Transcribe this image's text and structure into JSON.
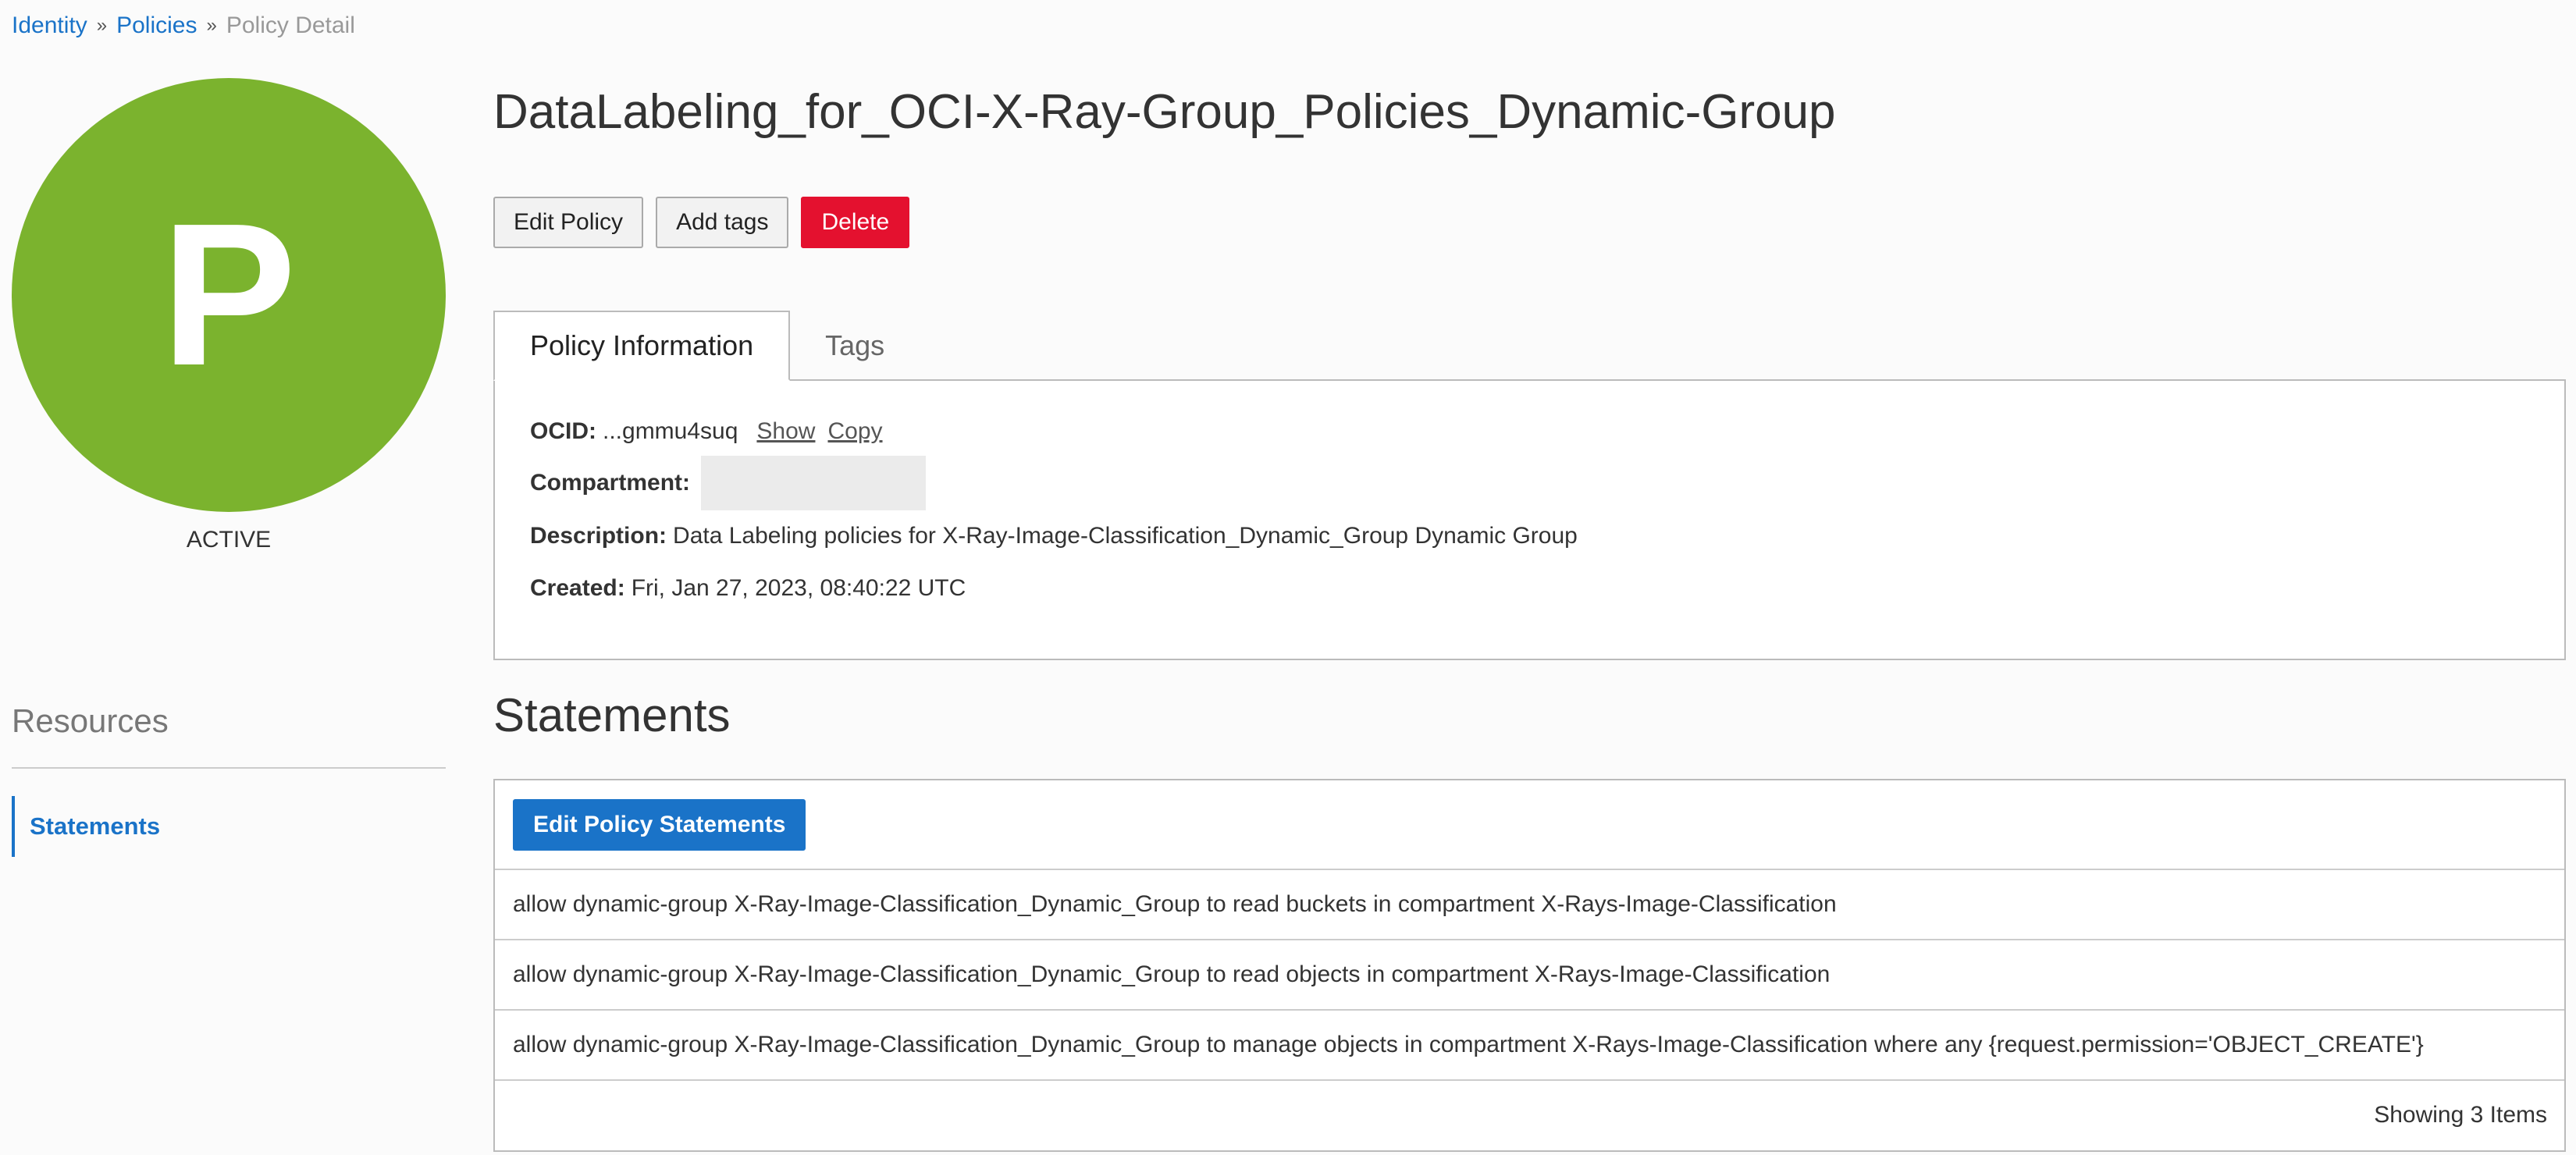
{
  "breadcrumb": {
    "identity": "Identity",
    "policies": "Policies",
    "current": "Policy Detail",
    "separator": "»"
  },
  "avatar": {
    "letter": "P",
    "color": "#7bb32e"
  },
  "status": "ACTIVE",
  "title": "DataLabeling_for_OCI-X-Ray-Group_Policies_Dynamic-Group",
  "actions": {
    "edit_policy": "Edit Policy",
    "add_tags": "Add tags",
    "delete": "Delete"
  },
  "tabs": [
    {
      "label": "Policy Information",
      "active": true
    },
    {
      "label": "Tags",
      "active": false
    }
  ],
  "policy_info": {
    "ocid_label": "OCID:",
    "ocid_value": "...gmmu4suq",
    "show_link": "Show",
    "copy_link": "Copy",
    "compartment_label": "Compartment:",
    "description_label": "Description:",
    "description_value": "Data Labeling policies for X-Ray-Image-Classification_Dynamic_Group Dynamic Group",
    "created_label": "Created:",
    "created_value": "Fri, Jan 27, 2023, 08:40:22 UTC"
  },
  "resources": {
    "heading": "Resources",
    "items": [
      {
        "label": "Statements",
        "active": true
      }
    ]
  },
  "statements": {
    "heading": "Statements",
    "edit_button": "Edit Policy Statements",
    "rows": [
      "allow dynamic-group X-Ray-Image-Classification_Dynamic_Group to read buckets in compartment X-Rays-Image-Classification",
      "allow dynamic-group X-Ray-Image-Classification_Dynamic_Group to read objects in compartment X-Rays-Image-Classification",
      "allow dynamic-group X-Ray-Image-Classification_Dynamic_Group to manage objects in compartment X-Rays-Image-Classification where any {request.permission='OBJECT_CREATE'}"
    ],
    "footer": "Showing 3 Items"
  },
  "colors": {
    "link": "#1a73c8",
    "danger": "#e4112f",
    "primary": "#1a73c8",
    "avatar": "#7bb32e"
  }
}
